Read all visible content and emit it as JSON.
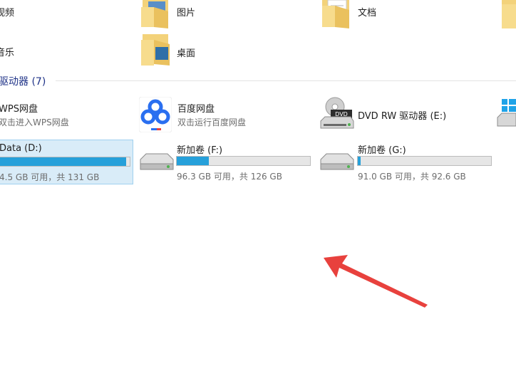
{
  "folders": [
    {
      "label": "视频"
    },
    {
      "label": "图片"
    },
    {
      "label": "文档"
    },
    {
      "label": "音乐"
    },
    {
      "label": "桌面"
    }
  ],
  "section": {
    "title": "驱动器 (7)"
  },
  "apps": [
    {
      "name": "WPS网盘",
      "subtitle": "双击进入WPS网盘"
    },
    {
      "name": "百度网盘",
      "subtitle": "双击运行百度网盘"
    },
    {
      "name": "DVD RW 驱动器 (E:)",
      "badge": "DVD"
    }
  ],
  "drives": [
    {
      "name": "Data (D:)",
      "usage": "4.5 GB 可用，共 131 GB",
      "used_fraction": 0.97,
      "color": "#26a0da"
    },
    {
      "name": "新加卷 (F:)",
      "usage": "96.3 GB 可用，共 126 GB",
      "used_fraction": 0.24,
      "color": "#26a0da"
    },
    {
      "name": "新加卷 (G:)",
      "usage": "91.0 GB 可用，共 92.6 GB",
      "used_fraction": 0.02,
      "color": "#26a0da"
    }
  ],
  "colors": {
    "accent": "#26a0da",
    "header": "#1e3287",
    "arrow": "#e8413d"
  }
}
